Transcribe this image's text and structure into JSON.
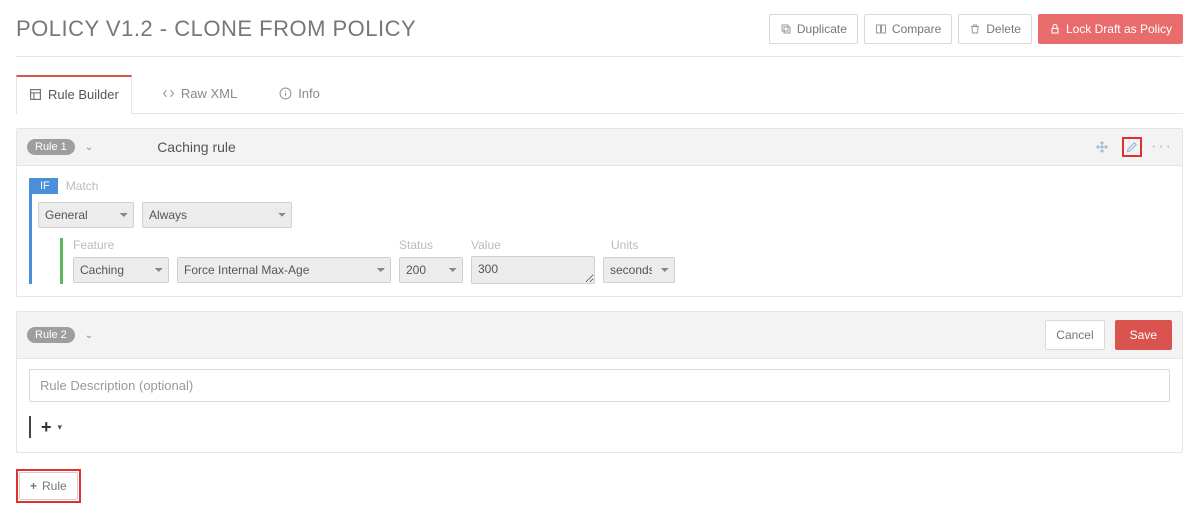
{
  "header": {
    "title": "POLICY V1.2 - CLONE FROM POLICY",
    "duplicate": "Duplicate",
    "compare": "Compare",
    "delete": "Delete",
    "lock": "Lock Draft as Policy"
  },
  "tabs": {
    "builder": "Rule Builder",
    "xml": "Raw XML",
    "info": "Info"
  },
  "rule1": {
    "badge": "Rule 1",
    "title": "Caching rule",
    "if_label": "IF",
    "match_label": "Match",
    "match_category": "General",
    "match_value": "Always",
    "feature_label": "Feature",
    "status_label": "Status",
    "value_label": "Value",
    "units_label": "Units",
    "feature_category": "Caching",
    "feature_name": "Force Internal Max-Age",
    "status": "200",
    "value": "300",
    "units": "seconds"
  },
  "rule2": {
    "badge": "Rule 2",
    "cancel": "Cancel",
    "save": "Save",
    "desc_placeholder": "Rule Description (optional)"
  },
  "footer": {
    "add_rule": "Rule"
  }
}
